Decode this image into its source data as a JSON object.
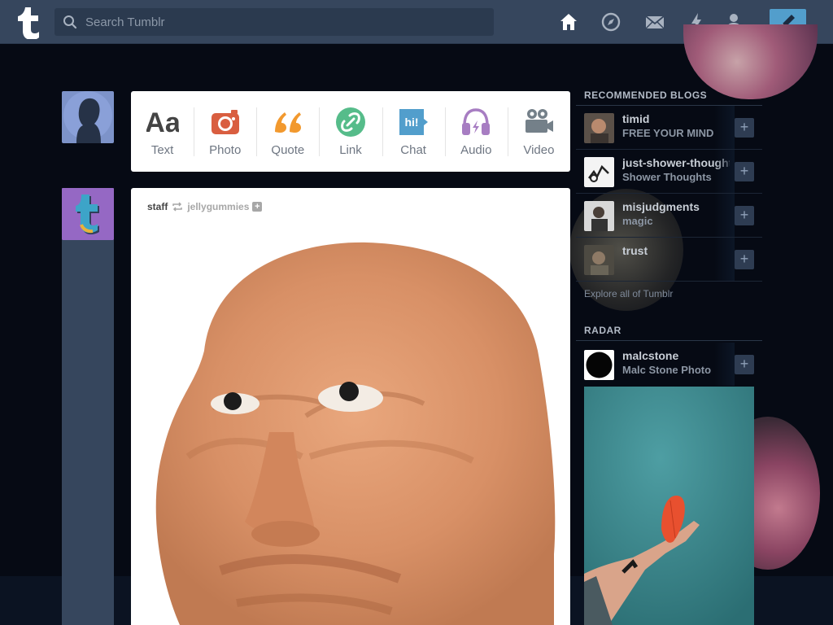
{
  "header": {
    "logo_icon": "tumblr-logo-icon",
    "search_placeholder": "Search Tumblr",
    "nav": [
      {
        "name": "home-icon",
        "active": true
      },
      {
        "name": "explore-compass-icon"
      },
      {
        "name": "inbox-mail-icon"
      },
      {
        "name": "activity-lightning-icon"
      },
      {
        "name": "account-person-icon"
      }
    ],
    "compose_icon": "pencil-icon"
  },
  "post_types": [
    {
      "label": "Text",
      "icon": "text-aa-icon",
      "color": "#444444"
    },
    {
      "label": "Photo",
      "icon": "camera-icon",
      "color": "#d95e40"
    },
    {
      "label": "Quote",
      "icon": "quote-icon",
      "color": "#f2992e"
    },
    {
      "label": "Link",
      "icon": "link-icon",
      "color": "#56bc8a"
    },
    {
      "label": "Chat",
      "icon": "chat-hi-icon",
      "color": "#529ecc",
      "glyph": "hi!"
    },
    {
      "label": "Audio",
      "icon": "headphones-icon",
      "color": "#a77dc2"
    },
    {
      "label": "Video",
      "icon": "video-camera-icon",
      "color": "#748089"
    }
  ],
  "post": {
    "author": "staff",
    "reblogged_from": "jellygummies",
    "image": "clay-face-sculpture"
  },
  "sidebar": {
    "recommended_title": "RECOMMENDED BLOGS",
    "blogs": [
      {
        "name": "timid",
        "tagline": "FREE YOUR MIND"
      },
      {
        "name": "just-shower-thoughts",
        "tagline": "Shower Thoughts"
      },
      {
        "name": "misjudgments",
        "tagline": "magic"
      },
      {
        "name": "trust",
        "tagline": ""
      }
    ],
    "explore_link": "Explore all of Tumblr",
    "radar_title": "RADAR",
    "radar_blog": {
      "name": "malcstone",
      "tagline": "Malc Stone Photo"
    },
    "radar_image": "hand-holding-red-leaf"
  },
  "colors": {
    "header_bg": "#36465d",
    "page_bg": "#060a14",
    "accent": "#529ecc"
  }
}
